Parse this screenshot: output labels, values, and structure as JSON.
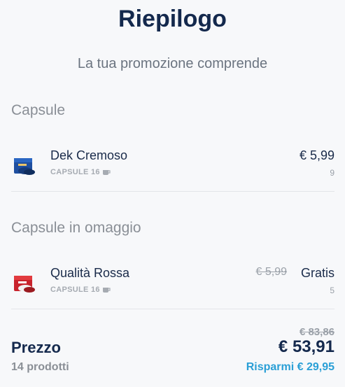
{
  "header": {
    "title": "Riepilogo",
    "subtitle": "La tua promozione comprende"
  },
  "sections": [
    {
      "title": "Capsule",
      "items": [
        {
          "name": "Dek Cremoso",
          "meta": "CAPSULE 16",
          "price": "€ 5,99",
          "qty": "9",
          "thumb_color": "#1f4fa0",
          "icon": "cup-icon"
        }
      ]
    },
    {
      "title": "Capsule in omaggio",
      "items": [
        {
          "name": "Qualità Rossa",
          "meta": "CAPSULE 16",
          "old_price": "€ 5,99",
          "price": "Gratis",
          "qty": "5",
          "thumb_color": "#c8232c",
          "icon": "cup-icon"
        }
      ]
    }
  ],
  "total": {
    "label": "Prezzo",
    "count": "14 prodotti",
    "old_price": "€ 83,86",
    "price": "€ 53,91",
    "savings": "Risparmi € 29,95",
    "savings_color": "#2a9fd6"
  }
}
